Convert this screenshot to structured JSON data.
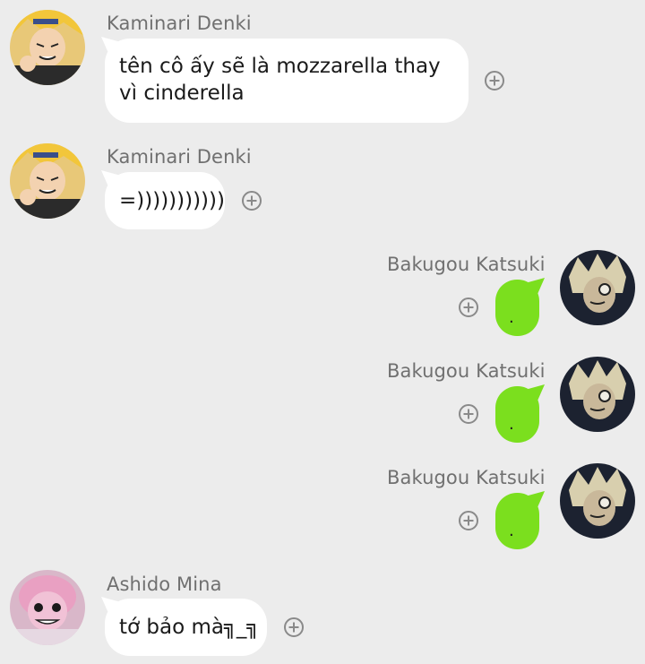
{
  "messages": [
    {
      "sender": "Kaminari Denki",
      "text": "tên cô ấy sẽ là mozzarella thay vì cinderella",
      "side": "left",
      "avatar": "kaminari-avatar"
    },
    {
      "sender": "Kaminari Denki",
      "text": "=)))))))))))",
      "side": "left",
      "avatar": "kaminari-avatar"
    },
    {
      "sender": "Bakugou Katsuki",
      "text": ".",
      "side": "right",
      "avatar": "bakugou-avatar"
    },
    {
      "sender": "Bakugou Katsuki",
      "text": ".",
      "side": "right",
      "avatar": "bakugou-avatar"
    },
    {
      "sender": "Bakugou Katsuki",
      "text": ".",
      "side": "right",
      "avatar": "bakugou-avatar"
    },
    {
      "sender": "Ashido Mina",
      "text": "tớ bảo mà╗_╗",
      "side": "left",
      "avatar": "ashido-avatar"
    }
  ],
  "colors": {
    "background": "#ececec",
    "bubble_white": "#ffffff",
    "bubble_green": "#7bdf1e",
    "name_gray": "#707070"
  },
  "icons": {
    "add_reaction": "plus-circle-icon"
  }
}
